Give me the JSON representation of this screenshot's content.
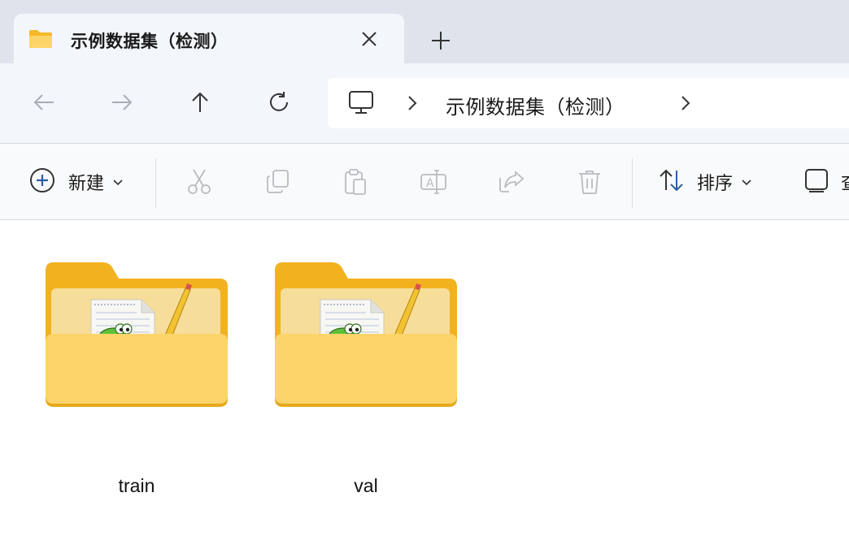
{
  "tab": {
    "title": "示例数据集（检测）",
    "icon": "folder-icon",
    "close_icon": "close-icon",
    "new_tab_icon": "plus-icon"
  },
  "nav": {
    "back_icon": "arrow-left-icon",
    "forward_icon": "arrow-right-icon",
    "up_icon": "arrow-up-icon",
    "refresh_icon": "refresh-icon"
  },
  "address": {
    "root_icon": "computer-icon",
    "crumbs": [
      "示例数据集（检测）"
    ]
  },
  "commands": {
    "new_label": "新建",
    "sort_label": "排序",
    "view_label": "查",
    "icons": [
      "add-circle-icon",
      "cut-icon",
      "copy-icon",
      "paste-icon",
      "rename-icon",
      "share-icon",
      "delete-icon",
      "sort-icon",
      "view-icon"
    ]
  },
  "items": [
    {
      "name": "train",
      "icon": "folder-with-document-icon"
    },
    {
      "name": "val",
      "icon": "folder-with-document-icon"
    }
  ],
  "colors": {
    "tabstrip_bg": "#dfe4ec",
    "navbar_bg": "#f3f6fb",
    "folder_back": "#f4b827",
    "folder_front": "#fcd46a",
    "accent_blue": "#2b5ea7"
  }
}
